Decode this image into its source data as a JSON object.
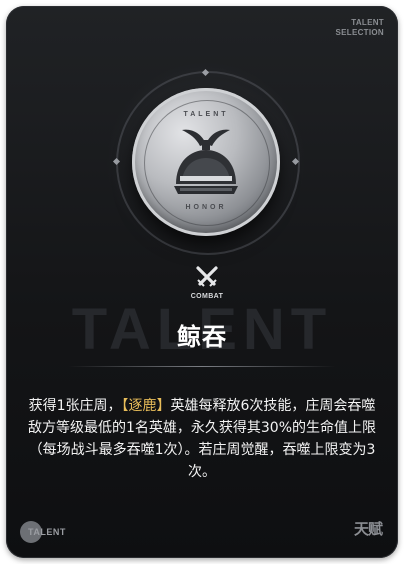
{
  "card": {
    "corner_label_line1": "TALENT",
    "corner_label_line2": "SELECTION",
    "medallion_top_text": "TALENT",
    "medallion_bottom_text": "HONOR",
    "type_label": "COMBAT",
    "watermark": "TALENT",
    "title": "鲸吞",
    "description": {
      "part1": "获得1张庄周，",
      "highlight": "【逐鹿】",
      "part2": "英雄每释放6次技能，庄周会吞噬敌方等级最低的1名英雄，永久获得其30%的生命值上限（每场战斗最多吞噬1次）。若庄周觉醒，吞噬上限变为3次。"
    },
    "footer_logo_text": "TALENT",
    "footer_seal": "天赋"
  },
  "colors": {
    "card_bg": "#141517",
    "highlight": "#e8bd5a",
    "text": "#f3f3f3"
  },
  "icons": {
    "medallion": "whale-helmet-icon",
    "type": "crossed-swords-icon"
  }
}
